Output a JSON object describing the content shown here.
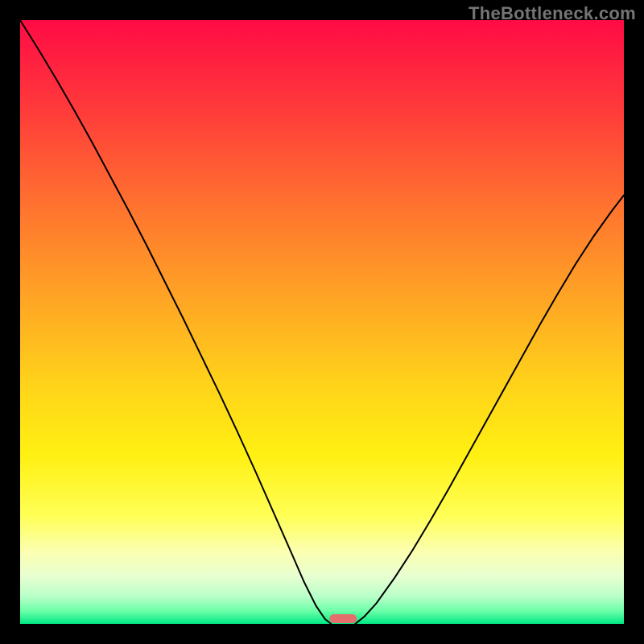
{
  "watermark": "TheBottleneck.com",
  "chart_data": {
    "type": "line",
    "title": "",
    "xlabel": "",
    "ylabel": "",
    "xlim": [
      0,
      100
    ],
    "ylim": [
      0,
      100
    ],
    "grid": false,
    "legend": false,
    "gradient_stops": [
      {
        "pos": 0.0,
        "color": "#ff0b45"
      },
      {
        "pos": 0.15,
        "color": "#ff3b3a"
      },
      {
        "pos": 0.3,
        "color": "#ff7030"
      },
      {
        "pos": 0.45,
        "color": "#ffa125"
      },
      {
        "pos": 0.6,
        "color": "#ffd21a"
      },
      {
        "pos": 0.72,
        "color": "#fff012"
      },
      {
        "pos": 0.82,
        "color": "#ffff55"
      },
      {
        "pos": 0.88,
        "color": "#fbffb0"
      },
      {
        "pos": 0.92,
        "color": "#e9ffd0"
      },
      {
        "pos": 0.955,
        "color": "#b8ffc8"
      },
      {
        "pos": 0.978,
        "color": "#6effa8"
      },
      {
        "pos": 1.0,
        "color": "#00e985"
      }
    ],
    "series": [
      {
        "name": "left-curve",
        "type": "line",
        "color": "#000000",
        "width": 2,
        "x": [
          0.0,
          3.0,
          6.0,
          9.0,
          12.0,
          15.0,
          18.0,
          21.0,
          24.0,
          27.0,
          30.0,
          33.0,
          36.0,
          39.0,
          42.0,
          45.0,
          47.0,
          49.0,
          50.5,
          51.5
        ],
        "y": [
          100.0,
          95.2,
          90.2,
          85.0,
          79.6,
          74.0,
          68.4,
          62.6,
          56.6,
          50.6,
          44.4,
          38.2,
          31.8,
          25.2,
          18.4,
          11.6,
          7.0,
          3.0,
          0.8,
          0.0
        ]
      },
      {
        "name": "right-curve",
        "type": "line",
        "color": "#000000",
        "width": 2,
        "x": [
          55.5,
          57.0,
          59.0,
          62.0,
          65.0,
          68.0,
          71.0,
          74.0,
          77.0,
          80.0,
          83.0,
          86.0,
          89.0,
          92.0,
          95.0,
          98.0,
          100.0
        ],
        "y": [
          0.0,
          1.2,
          3.4,
          7.6,
          12.2,
          17.2,
          22.4,
          27.8,
          33.2,
          38.6,
          44.0,
          49.4,
          54.6,
          59.6,
          64.2,
          68.4,
          71.0
        ]
      }
    ],
    "marker": {
      "name": "bottleneck-marker",
      "x_center": 53.5,
      "width": 4.5,
      "color": "#e46f6d"
    }
  }
}
